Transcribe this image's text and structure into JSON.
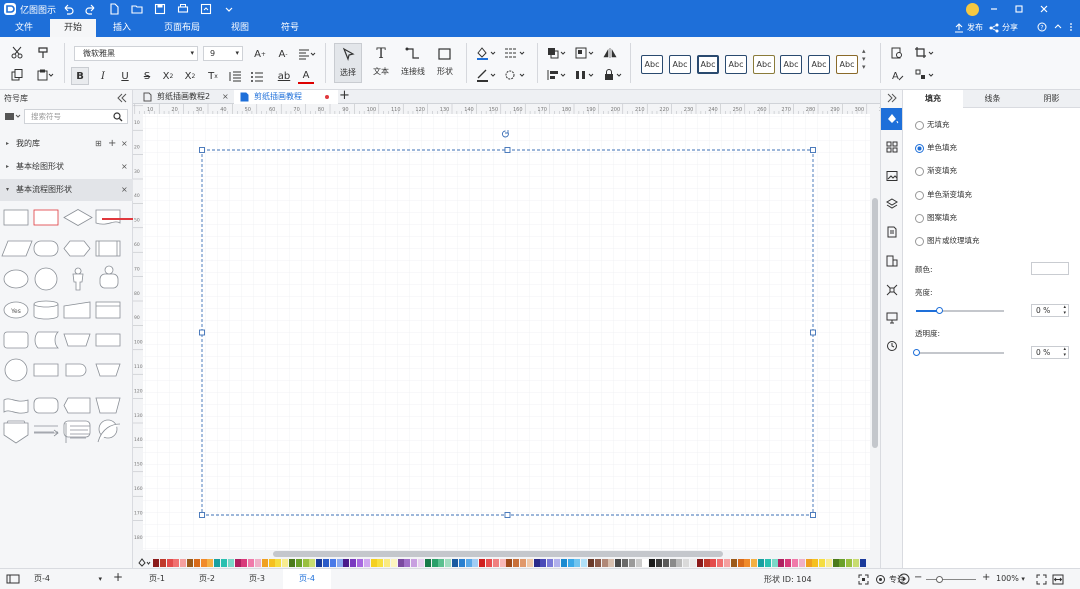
{
  "app": {
    "title": "亿图图示"
  },
  "menu": {
    "tabs": [
      "文件",
      "开始",
      "插入",
      "页面布局",
      "视图",
      "符号"
    ],
    "active": "开始",
    "publish": "发布",
    "share": "分享"
  },
  "toolbar": {
    "font_name": "微软雅黑",
    "font_size": "9",
    "select_label": "选择",
    "text_label": "文本",
    "connector_label": "连接线",
    "shape_label": "形状",
    "style_swatch_text": "Abc"
  },
  "library": {
    "title": "符号库",
    "search_placeholder": "搜索符号",
    "items": [
      "我的库",
      "基本绘图形状",
      "基本流程图形状"
    ],
    "shape_yes": "Yes"
  },
  "doc_tabs": [
    "剪纸插画教程2",
    "剪纸插画教程"
  ],
  "ruler": {
    "h_ticks": [
      "10",
      "20",
      "30",
      "40",
      "50",
      "60",
      "70",
      "80",
      "90",
      "100",
      "110",
      "120",
      "130",
      "140",
      "150",
      "160",
      "170",
      "180",
      "190",
      "200",
      "210",
      "220",
      "230",
      "240",
      "250",
      "260",
      "270",
      "280",
      "290",
      "300",
      "310",
      "320",
      "330",
      "340"
    ],
    "v_ticks": [
      "10",
      "20",
      "30",
      "40",
      "50",
      "60",
      "70",
      "80",
      "90",
      "100",
      "110",
      "120",
      "130",
      "140",
      "150",
      "160",
      "170",
      "180"
    ]
  },
  "right_panel": {
    "tabs": [
      "填充",
      "线条",
      "阴影"
    ],
    "fill_options": [
      "无填充",
      "单色填充",
      "渐变填充",
      "单色渐变填充",
      "图案填充",
      "图片或纹理填充"
    ],
    "selected_fill": "单色填充",
    "color_label": "颜色:",
    "brightness_label": "亮度:",
    "brightness_value": "0 %",
    "brightness_level": 0.5,
    "transparency_label": "透明度:",
    "transparency_value": "0 %",
    "transparency_level": 0
  },
  "status": {
    "page_selector": "页-4",
    "pages": [
      "页-1",
      "页-2",
      "页-3",
      "页-4"
    ],
    "active_page": "页-4",
    "shape_id_label": "形状 ID: 104",
    "focus_label": "专注",
    "zoom": "100%"
  },
  "colors": {
    "accent": "#1e6fd9",
    "arrow": "#e0383d"
  }
}
